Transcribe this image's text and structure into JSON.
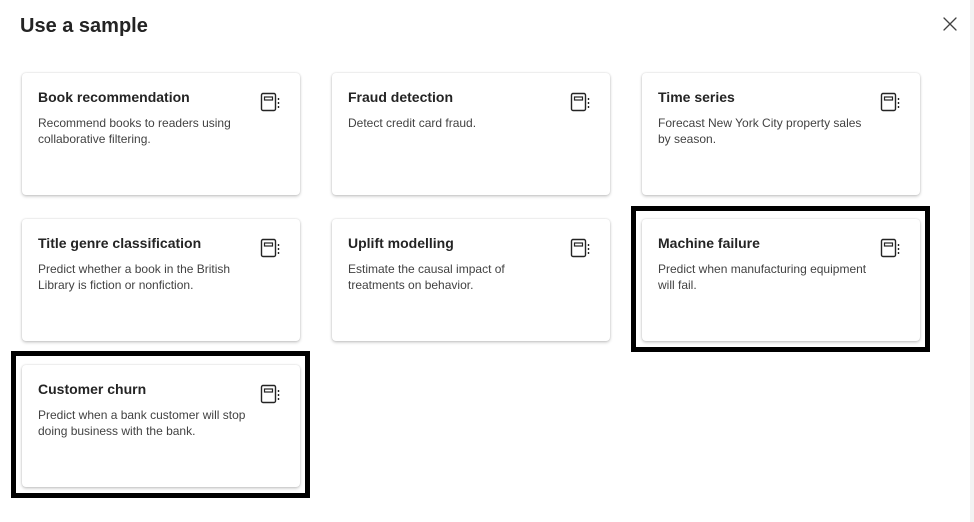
{
  "dialog": {
    "title": "Use a sample",
    "close_icon": "close-icon"
  },
  "samples": [
    {
      "title": "Book recommendation",
      "description": "Recommend books to readers using collaborative filtering.",
      "icon": "notebook-icon"
    },
    {
      "title": "Fraud detection",
      "description": "Detect credit card fraud.",
      "icon": "notebook-icon"
    },
    {
      "title": "Time series",
      "description": "Forecast New York City property sales by season.",
      "icon": "notebook-icon"
    },
    {
      "title": "Title genre classification",
      "description": "Predict whether a book in the British Library is fiction or nonfiction.",
      "icon": "notebook-icon"
    },
    {
      "title": "Uplift modelling",
      "description": "Estimate the causal impact of treatments on behavior.",
      "icon": "notebook-icon"
    },
    {
      "title": "Machine failure",
      "description": "Predict when manufacturing equipment will fail.",
      "icon": "notebook-icon"
    },
    {
      "title": "Customer churn",
      "description": "Predict when a bank customer will stop doing business with the bank.",
      "icon": "notebook-icon"
    }
  ],
  "annotations": {
    "highlight_color": "#000000",
    "highlighted_cards": [
      "Machine failure",
      "Customer churn"
    ]
  }
}
